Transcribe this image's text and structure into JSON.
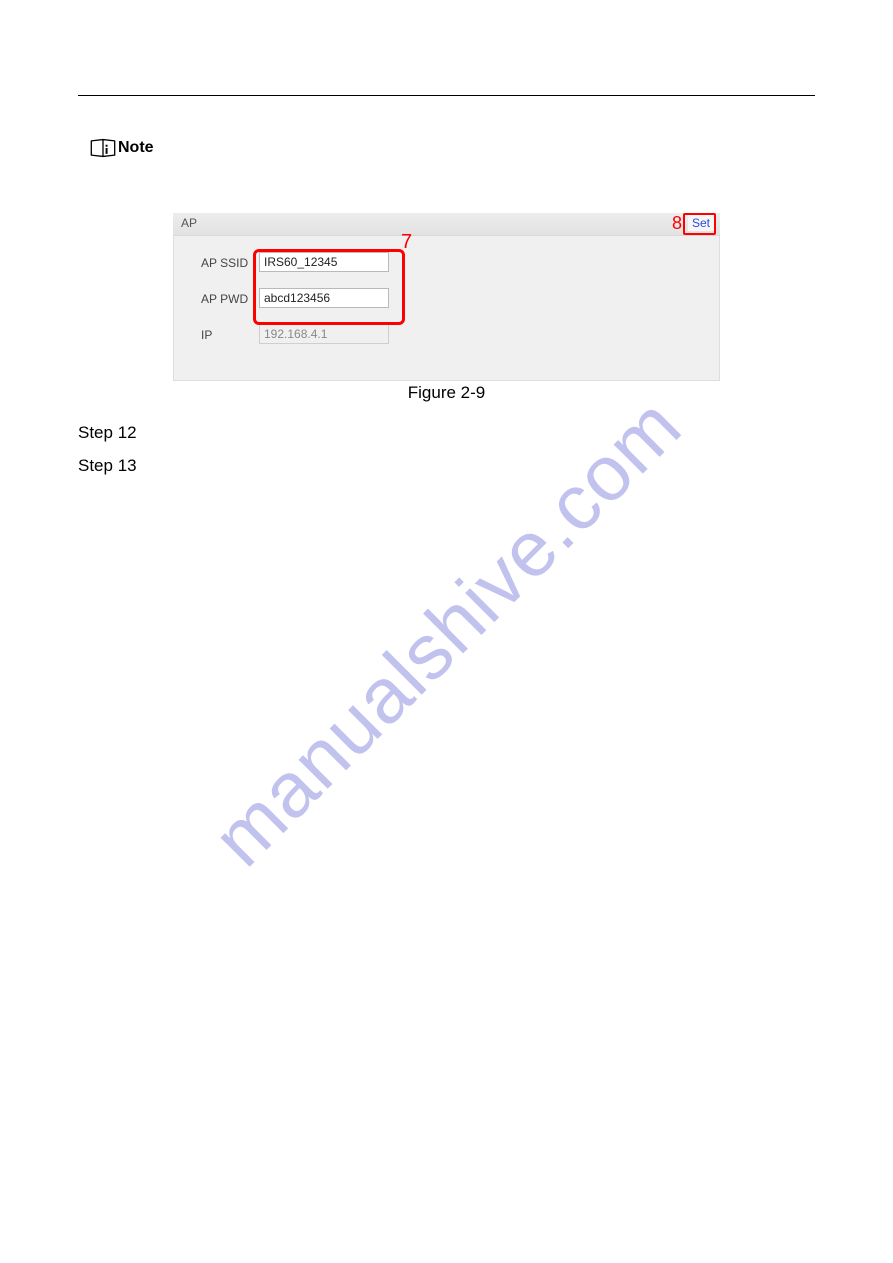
{
  "note": {
    "label": "Note"
  },
  "ap": {
    "panel_title": "AP",
    "set_label": "Set",
    "ssid_label": "AP SSID",
    "ssid_value": "IRS60_12345",
    "pwd_label": "AP PWD",
    "pwd_value": "abcd123456",
    "ip_label": "IP",
    "ip_value": "192.168.4.1"
  },
  "annotations": {
    "seven": "7",
    "eight": "8"
  },
  "caption": "Figure 2-9",
  "steps": {
    "s12": "Step 12",
    "s13": "Step 13"
  },
  "watermark": "manualshive.com"
}
